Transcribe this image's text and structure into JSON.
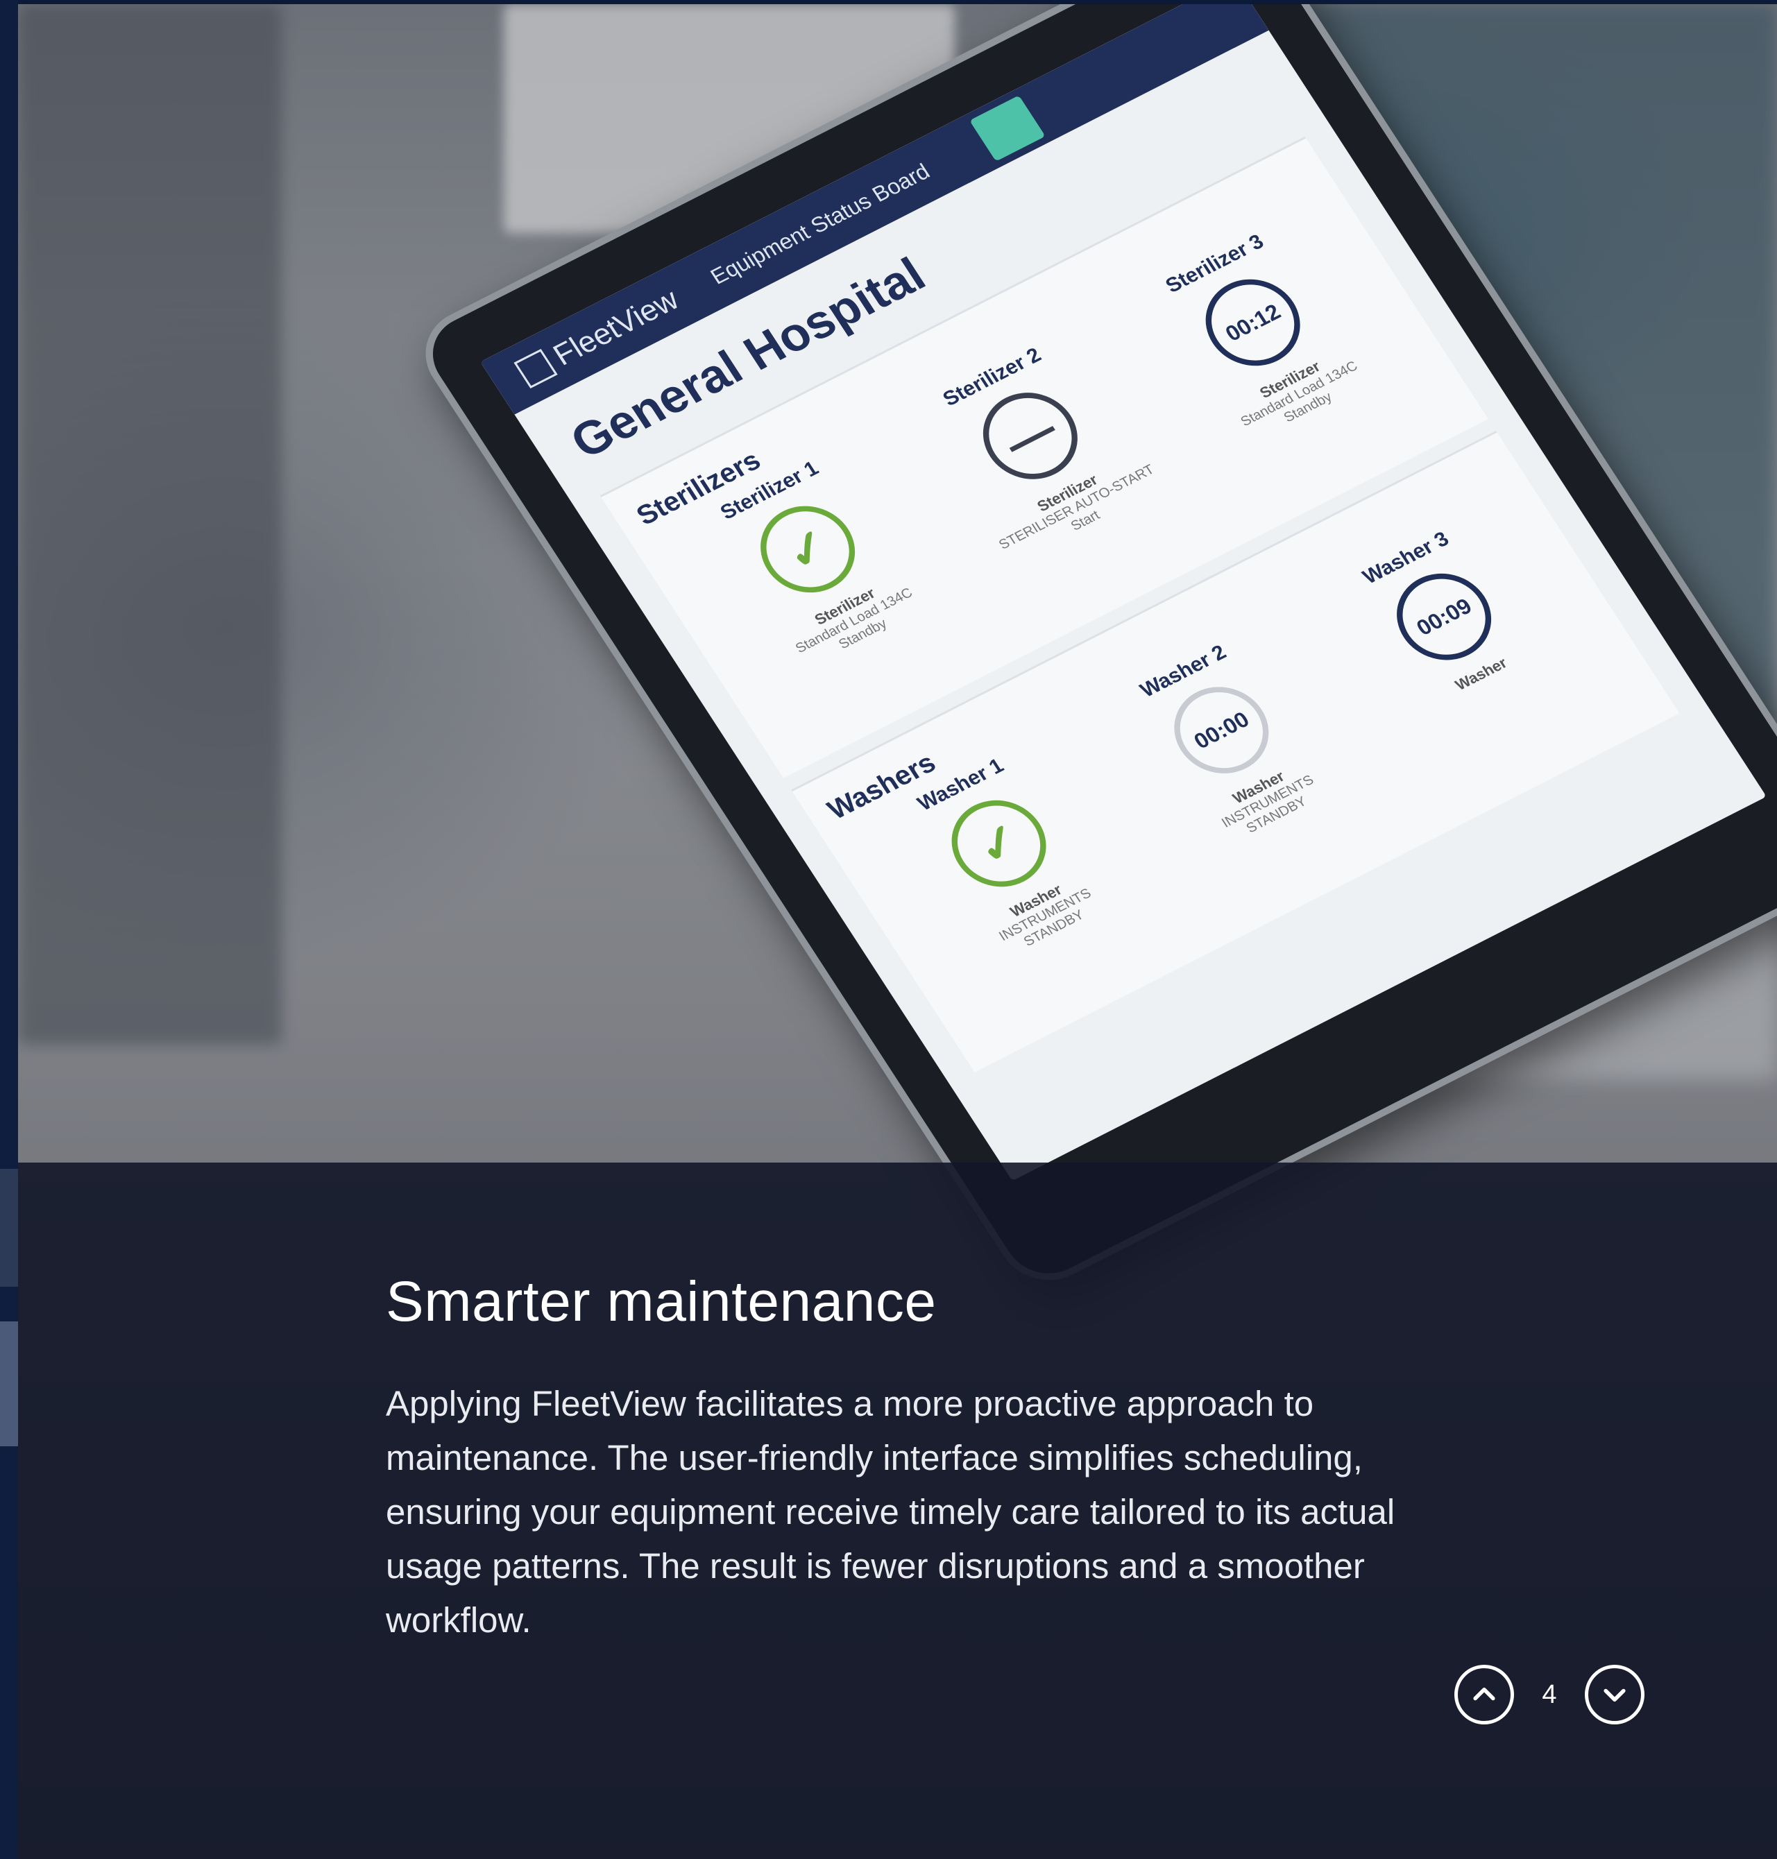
{
  "slide": {
    "heading": "Smarter maintenance",
    "body": "Applying FleetView facilitates a more proactive approach to maintenance. The user-friendly interface simplifies scheduling, ensuring your equipment receive timely care tailored to its actual usage patterns. The result is fewer disruptions and a smoother workflow."
  },
  "pagination": {
    "current": "4",
    "prev_icon": "chevron-up-icon",
    "next_icon": "chevron-down-icon"
  },
  "tablet_screen": {
    "brand": "FleetView",
    "title": "Equipment Status Board",
    "hospital": "General Hospital",
    "sections": [
      {
        "title": "Sterilizers",
        "units": [
          {
            "name": "Sterilizer 1",
            "dial": "✓",
            "status": "ok",
            "type": "Sterilizer",
            "program": "Standard Load 134C",
            "state": "Standby"
          },
          {
            "name": "Sterilizer 2",
            "dial": "—",
            "status": "off",
            "type": "Sterilizer",
            "program": "STERILISER AUTO-START",
            "state": "Start"
          },
          {
            "name": "Sterilizer 3",
            "dial": "00:12",
            "status": "run",
            "type": "Sterilizer",
            "program": "Standard Load 134C",
            "state": "Standby"
          }
        ]
      },
      {
        "title": "Washers",
        "units": [
          {
            "name": "Washer 1",
            "dial": "✓",
            "status": "ok",
            "type": "Washer",
            "program": "INSTRUMENTS",
            "state": "STANDBY"
          },
          {
            "name": "Washer 2",
            "dial": "00:00",
            "status": "idle",
            "type": "Washer",
            "program": "INSTRUMENTS",
            "state": "STANDBY"
          },
          {
            "name": "Washer 3",
            "dial": "00:09",
            "status": "run",
            "type": "Washer",
            "program": "",
            "state": ""
          }
        ]
      }
    ]
  },
  "colors": {
    "caption_overlay": "#121628",
    "navy": "#1f2f5a",
    "accent_green": "#6aaa3a",
    "teal_button": "#4ec2a8"
  }
}
